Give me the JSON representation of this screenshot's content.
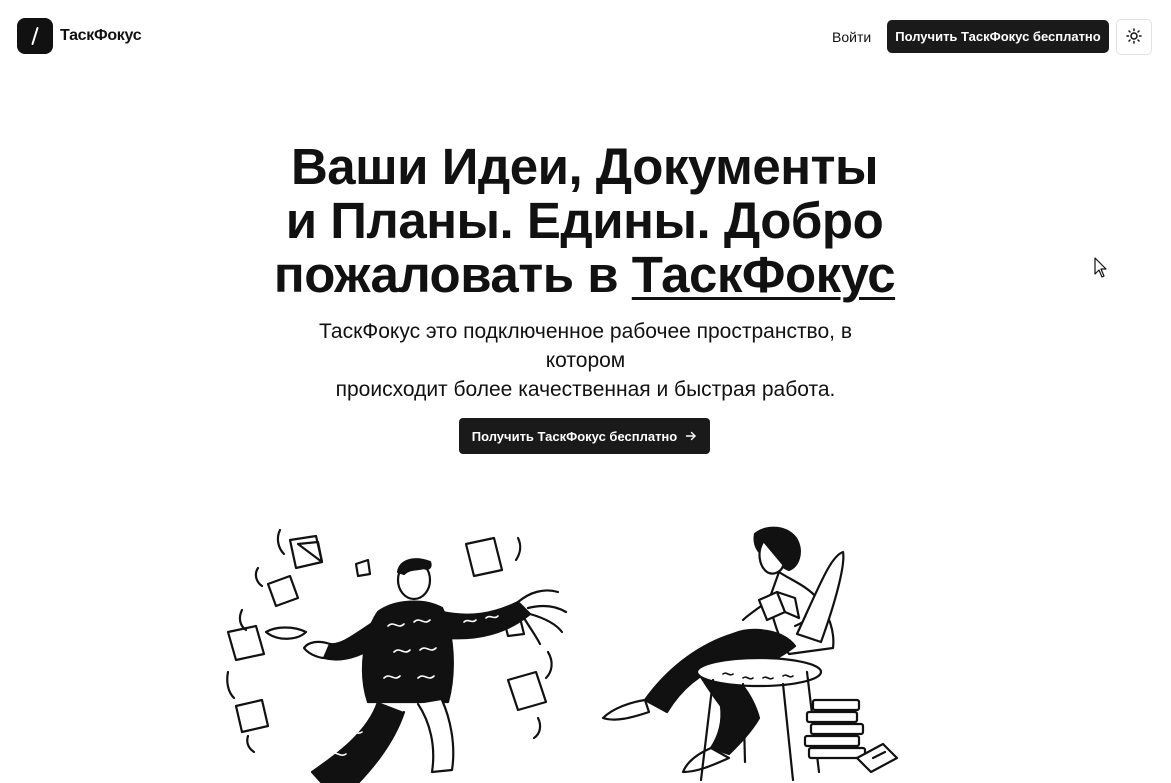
{
  "header": {
    "brand": "ТаскФокус",
    "login_label": "Войти",
    "cta_label": "Получить ТаскФокус бесплатно",
    "logo_icon": "slash-logo-icon",
    "theme_icon": "sun-icon"
  },
  "hero": {
    "title_line1": "Ваши Идеи, Документы",
    "title_line2": "и Планы. Едины. Добро",
    "title_line3_prefix": "пожаловать в ",
    "title_brand": "ТаскФокус",
    "subtitle_line1": "ТаскФокус это подключенное рабочее пространство, в",
    "subtitle_line2": "котором",
    "subtitle_line3": "происходит более качественная и быстрая работа.",
    "cta_label": "Получить ТаскФокус бесплатно",
    "cta_icon": "arrow-right-icon"
  },
  "colors": {
    "text": "#111111",
    "button_bg": "#1a1a1a",
    "button_text": "#ffffff",
    "border": "#e2e2e2"
  }
}
